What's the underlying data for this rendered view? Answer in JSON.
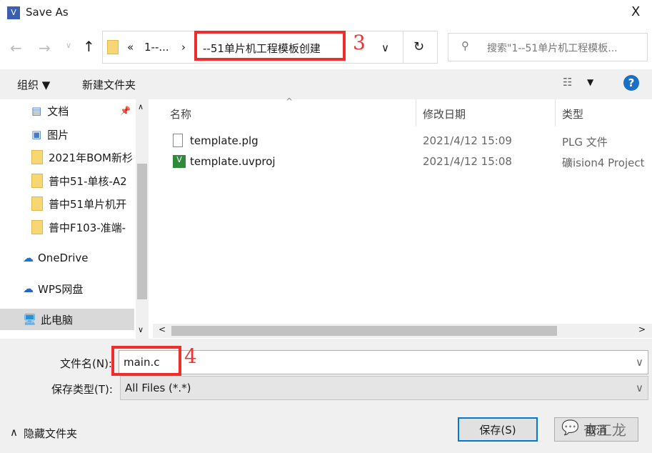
{
  "window": {
    "title": "Save As",
    "close": "X"
  },
  "nav": {
    "path_prefix": "«",
    "path_parent": "1--...",
    "path_sep": "›",
    "path_current": "--51单片机工程模板创建",
    "annotation_3": "3",
    "search_placeholder": "搜索\"1--51单片机工程模板..."
  },
  "toolbar": {
    "organize": "组织 ▼",
    "new_folder": "新建文件夹",
    "view": "▼",
    "help": "?"
  },
  "sidebar": {
    "items": [
      {
        "label": "文档",
        "icon": "documents-icon"
      },
      {
        "label": "图片",
        "icon": "pictures-icon"
      },
      {
        "label": "2021年BOM新杉",
        "icon": "folder-icon"
      },
      {
        "label": "普中51-单核-A2",
        "icon": "folder-icon"
      },
      {
        "label": "普中51单片机开",
        "icon": "folder-icon"
      },
      {
        "label": "普中F103-准端-",
        "icon": "folder-icon"
      },
      {
        "label": "OneDrive",
        "icon": "cloud-icon"
      },
      {
        "label": "WPS网盘",
        "icon": "cloud-icon"
      },
      {
        "label": "此电脑",
        "icon": "computer-icon"
      }
    ]
  },
  "files": {
    "columns": [
      "名称",
      "修改日期",
      "类型"
    ],
    "rows": [
      {
        "name": "template.plg",
        "date": "2021/4/12 15:09",
        "type": "PLG 文件",
        "icon": "file-icon"
      },
      {
        "name": "template.uvproj",
        "date": "2021/4/12 15:08",
        "type": "礦ision4 Project",
        "icon": "keil-project-icon"
      }
    ]
  },
  "form": {
    "filename_label": "文件名(N):",
    "filename_value": "main.c",
    "annotation_4": "4",
    "filetype_label": "保存类型(T):",
    "filetype_value": "All Files (*.*)"
  },
  "footer": {
    "hide_folders": "隐藏文件夹",
    "save": "保存(S)",
    "cancel": "取消",
    "watermark": "杳工龙"
  }
}
